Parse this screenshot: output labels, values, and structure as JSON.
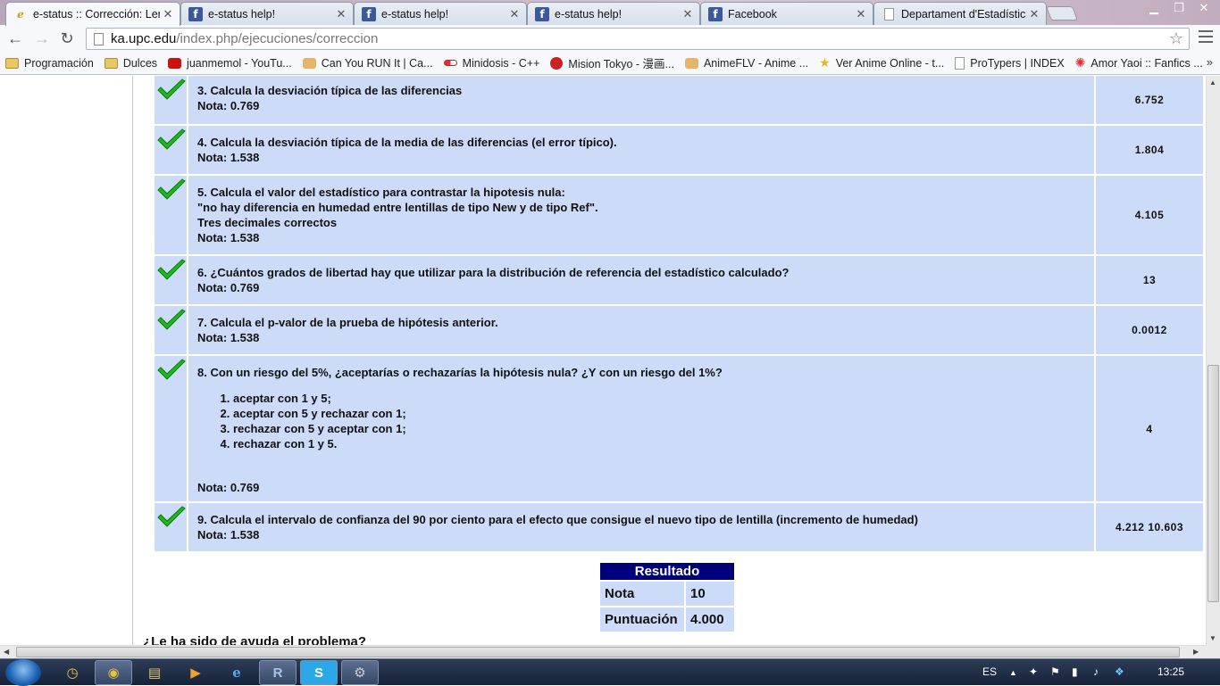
{
  "browser": {
    "tabs": [
      {
        "title": "e-status :: Corrección: Len",
        "icon": "e-status-icon",
        "active": true
      },
      {
        "title": "e-status help!",
        "icon": "facebook-icon",
        "active": false
      },
      {
        "title": "e-status help!",
        "icon": "facebook-icon",
        "active": false
      },
      {
        "title": "e-status help!",
        "icon": "facebook-icon",
        "active": false
      },
      {
        "title": "Facebook",
        "icon": "facebook-icon",
        "active": false
      },
      {
        "title": "Departament d'Estadística",
        "icon": "page-icon",
        "active": false
      }
    ],
    "tab_close": "✕",
    "url_host": "ka.upc.edu",
    "url_path": "/index.php/ejecuciones/correccion",
    "bookmarks": [
      {
        "label": "Programación",
        "icon": "folder-icon"
      },
      {
        "label": "Dulces",
        "icon": "folder-icon"
      },
      {
        "label": "juanmemol - YouTu...",
        "icon": "youtube-icon"
      },
      {
        "label": "Can You RUN It | Ca...",
        "icon": "can-you-run-it-icon"
      },
      {
        "label": "Minidosis - C++",
        "icon": "pill-icon"
      },
      {
        "label": "Mision Tokyo - 漫画...",
        "icon": "red-circle-icon"
      },
      {
        "label": "AnimeFLV - Anime ...",
        "icon": "hand-icon"
      },
      {
        "label": "Ver Anime Online - t...",
        "icon": "star-icon"
      },
      {
        "label": "ProTypers | INDEX",
        "icon": "page-icon"
      },
      {
        "label": "Amor Yaoi :: Fanfics ...",
        "icon": "burst-icon"
      }
    ],
    "bookmarks_more": "»"
  },
  "questions": [
    {
      "lines": [
        "3. Calcula la desviación típica de las diferencias"
      ],
      "nota": "Nota: 0.769",
      "answer": "6.752",
      "correct": true
    },
    {
      "lines": [
        "4. Calcula la desviación típica de la media de las diferencias (el error típico)."
      ],
      "nota": "Nota: 1.538",
      "answer": "1.804",
      "correct": true
    },
    {
      "lines": [
        "5. Calcula el valor del estadístico para contrastar la hipotesis nula:",
        "\"no hay diferencia en humedad entre lentillas de tipo New y de tipo Ref\".",
        "Tres decimales correctos"
      ],
      "nota": "Nota: 1.538",
      "answer": "4.105",
      "correct": true
    },
    {
      "lines": [
        "6. ¿Cuántos grados de libertad hay que utilizar para la distribución de referencia del estadístico calculado?"
      ],
      "nota": "Nota: 0.769",
      "answer": "13",
      "correct": true
    },
    {
      "lines": [
        "7. Calcula el p-valor de la prueba de hipótesis anterior."
      ],
      "nota": "Nota: 1.538",
      "answer": "0.0012",
      "correct": true
    },
    {
      "lines": [
        "8. Con un riesgo del 5%, ¿aceptarías o rechazarías la hipótesis nula? ¿Y con un riesgo del 1%?"
      ],
      "options": [
        "aceptar con 1 y 5;",
        "aceptar con 5 y rechazar con 1;",
        "rechazar con 5 y aceptar con 1;",
        "rechazar con 1 y 5."
      ],
      "nota": "Nota: 0.769",
      "answer": "4",
      "correct": true
    },
    {
      "lines": [
        "9. Calcula el intervalo de confianza del 90 por ciento para el efecto que consigue el nuevo tipo de lentilla (incremento de humedad)"
      ],
      "nota": "Nota: 1.538",
      "answer": "4.212 10.603",
      "correct": true
    }
  ],
  "result": {
    "header": "Resultado",
    "rows": [
      {
        "label": "Nota",
        "value": "10"
      },
      {
        "label": "Puntuación",
        "value": "4.000"
      }
    ]
  },
  "help_question": "¿Le ha sido de ayuda el problema?",
  "taskbar": {
    "lang": "ES",
    "clock": "13:25"
  },
  "colors": {
    "row_bg": "#ccdcf8",
    "result_header_bg": "#00007a",
    "check_green": "#1db81d"
  }
}
